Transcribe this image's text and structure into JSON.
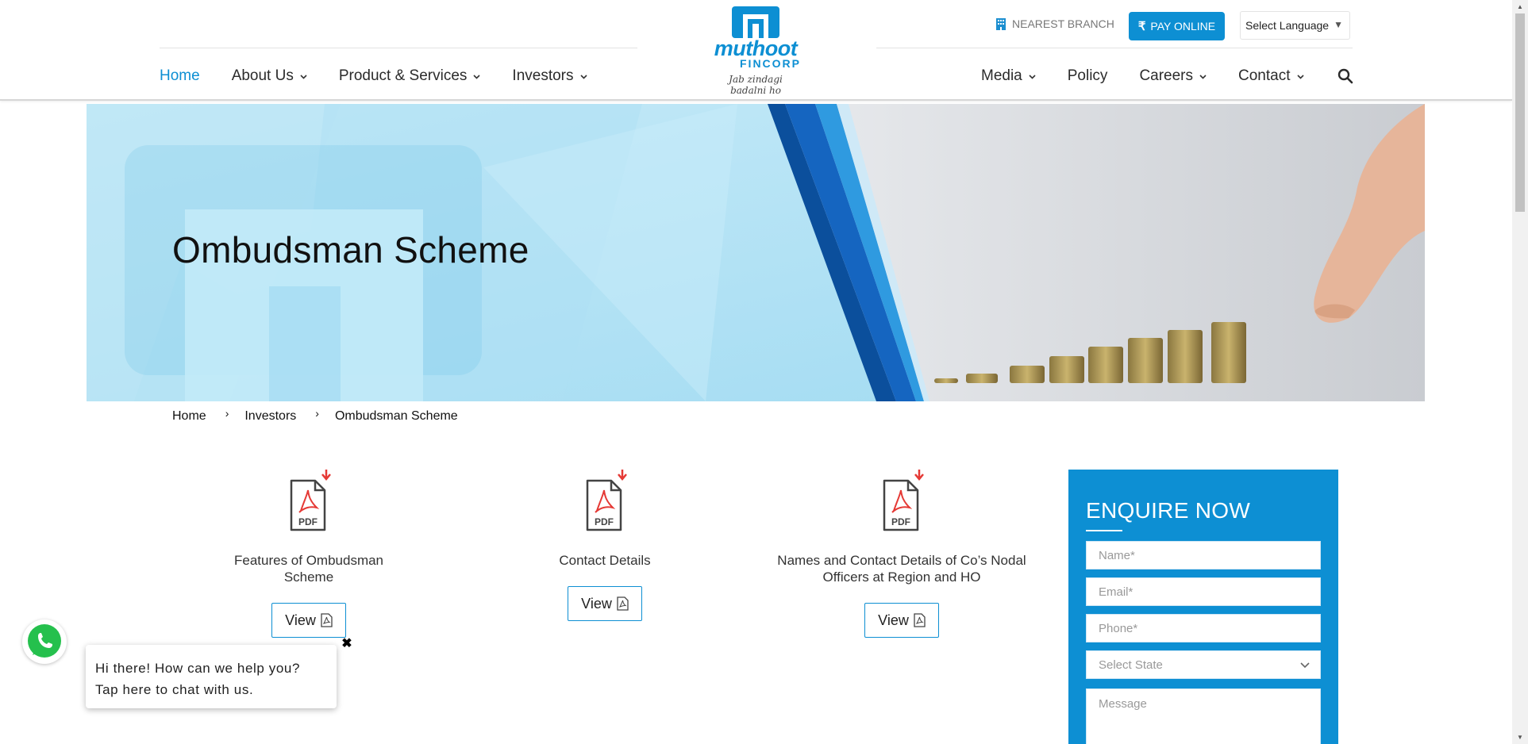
{
  "header": {
    "nav_left": [
      {
        "label": "Home",
        "active": true,
        "dropdown": false
      },
      {
        "label": "About Us",
        "active": false,
        "dropdown": true
      },
      {
        "label": "Product & Services",
        "active": false,
        "dropdown": true
      },
      {
        "label": "Investors",
        "active": false,
        "dropdown": true
      }
    ],
    "nav_right": [
      {
        "label": "Media",
        "dropdown": true
      },
      {
        "label": "Policy",
        "dropdown": false
      },
      {
        "label": "Careers",
        "dropdown": true
      },
      {
        "label": "Contact",
        "dropdown": true
      }
    ],
    "logo": {
      "word": "muthoot",
      "word2": "FINCORP",
      "tag": "Jab zindagi badalni ho"
    },
    "nearest_branch": "NEAREST BRANCH",
    "pay_online": "PAY ONLINE",
    "language": "Select Language",
    "accent": "#0d8fd3"
  },
  "hero": {
    "title": "Ombudsman Scheme"
  },
  "breadcrumb": [
    "Home",
    "Investors",
    "Ombudsman Scheme"
  ],
  "documents": [
    {
      "title": "Features of Ombudsman Scheme",
      "button": "View",
      "icon": "pdf-download-icon"
    },
    {
      "title": "Contact Details",
      "button": "View",
      "icon": "pdf-download-icon"
    },
    {
      "title": "Names and Contact Details of Co’s Nodal Officers at Region and HO",
      "button": "View",
      "icon": "pdf-download-icon"
    }
  ],
  "enquire": {
    "title": "ENQUIRE NOW",
    "name_placeholder": "Name*",
    "email_placeholder": "Email*",
    "phone_placeholder": "Phone*",
    "state_placeholder": "Select State",
    "message_placeholder": "Message"
  },
  "chat": {
    "message": "Hi there! How can we help you? Tap here to chat with us.",
    "close": "✖"
  }
}
